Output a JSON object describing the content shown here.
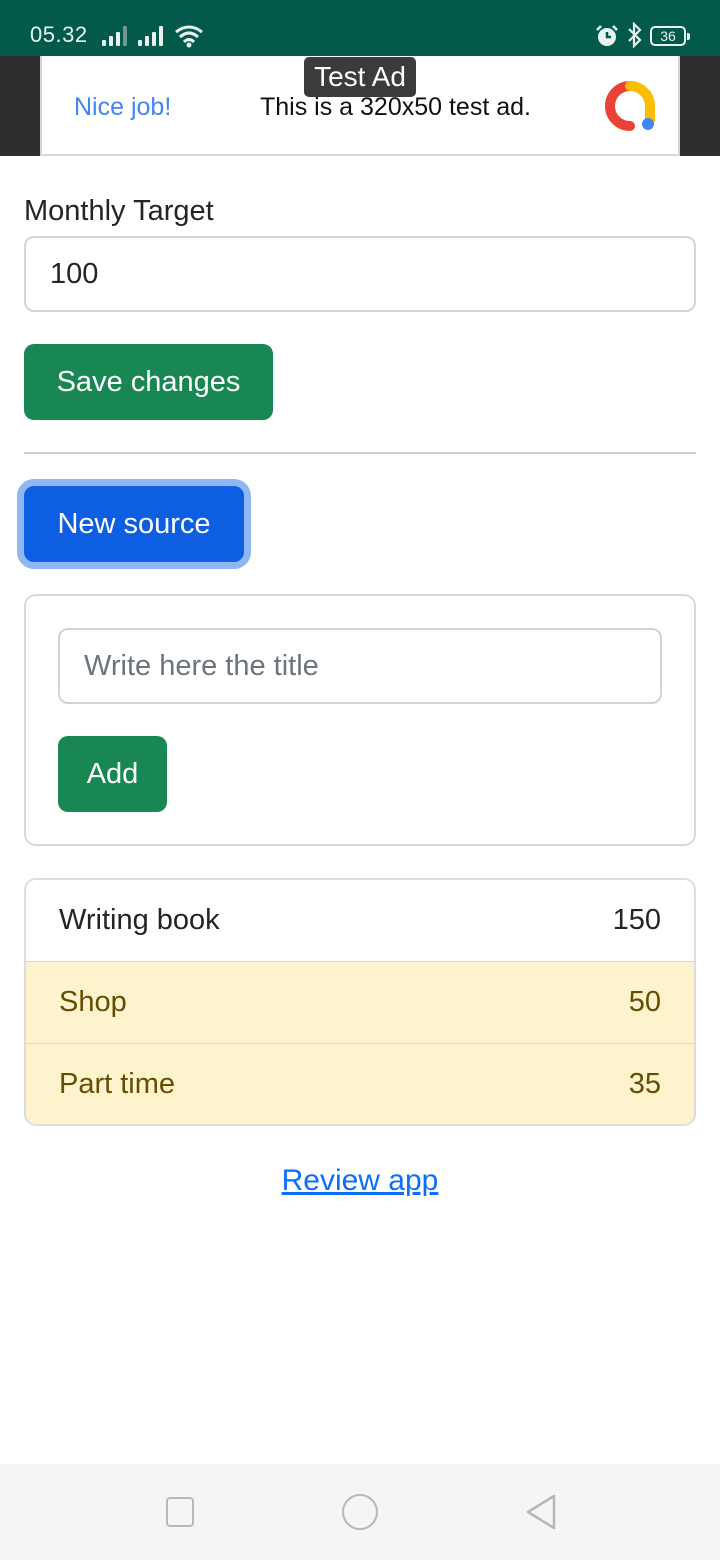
{
  "status_bar": {
    "time": "05.32",
    "battery": "36",
    "icons": [
      "signal-icon",
      "signal-icon",
      "wifi-icon",
      "alarm-icon",
      "bluetooth-icon",
      "battery-icon"
    ]
  },
  "ad": {
    "badge": "Test Ad",
    "headline": "Nice job!",
    "text": "This is a 320x50 test ad.",
    "logo": "admob-logo"
  },
  "form": {
    "target_label": "Monthly Target",
    "target_value": "100",
    "save_label": "Save changes",
    "new_source_label": "New source",
    "title_placeholder": "Write here the title",
    "add_label": "Add"
  },
  "sources": [
    {
      "name": "Writing book",
      "value": "150"
    },
    {
      "name": "Shop",
      "value": "50"
    },
    {
      "name": "Part time",
      "value": "35"
    }
  ],
  "review_link": "Review app",
  "colors": {
    "status_bar": "#035a4a",
    "success": "#198754",
    "primary": "#0d5ee0",
    "warning_bg": "#fff3cd",
    "warning_text": "#664d03",
    "link": "#0d6efd"
  },
  "navigation": [
    "recent-apps-icon",
    "home-icon",
    "back-icon"
  ]
}
